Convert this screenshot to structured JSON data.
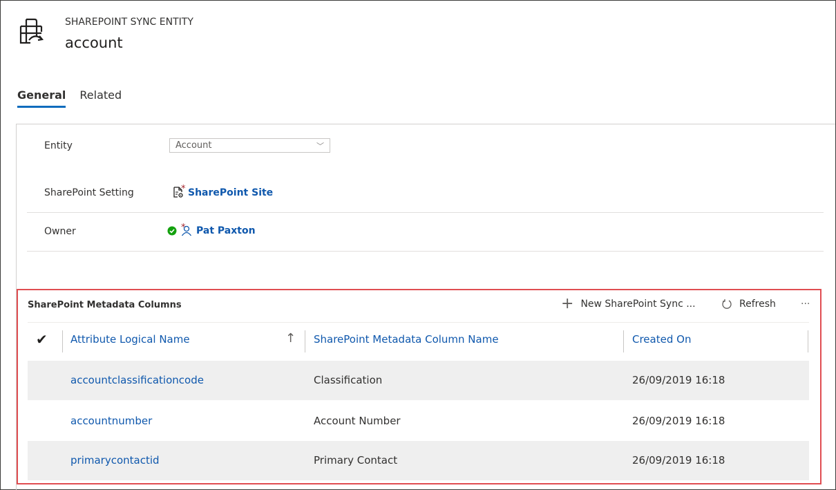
{
  "header": {
    "entity_type": "SHAREPOINT SYNC ENTITY",
    "record_name": "account"
  },
  "tabs": [
    {
      "label": "General",
      "active": true
    },
    {
      "label": "Related",
      "active": false
    }
  ],
  "form": {
    "entity": {
      "label": "Entity",
      "value": "Account"
    },
    "sharepoint_setting": {
      "label": "SharePoint Setting",
      "required": "*",
      "value": "SharePoint Site",
      "icon": "document-settings-icon"
    },
    "owner": {
      "label": "Owner",
      "required": "*",
      "value": "Pat Paxton",
      "icon": "person-icon",
      "status_icon": "available-status-icon"
    }
  },
  "grid": {
    "title": "SharePoint Metadata Columns",
    "commands": {
      "new_label": "New SharePoint Sync ...",
      "refresh_label": "Refresh",
      "more_label": "···"
    },
    "columns": {
      "check": "✔",
      "attribute": "Attribute Logical Name",
      "sort": "↑",
      "metadata": "SharePoint Metadata Column Name",
      "created": "Created On"
    },
    "rows": [
      {
        "attribute": "accountclassificationcode",
        "metadata": "Classification",
        "created": "26/09/2019 16:18"
      },
      {
        "attribute": "accountnumber",
        "metadata": "Account Number",
        "created": "26/09/2019 16:18"
      },
      {
        "attribute": "primarycontactid",
        "metadata": "Primary Contact",
        "created": "26/09/2019 16:18"
      }
    ]
  },
  "colors": {
    "accent_blue": "#0f58ad",
    "highlight_border": "#e04d51",
    "required_red": "#a4262c",
    "status_green": "#13a10e"
  }
}
